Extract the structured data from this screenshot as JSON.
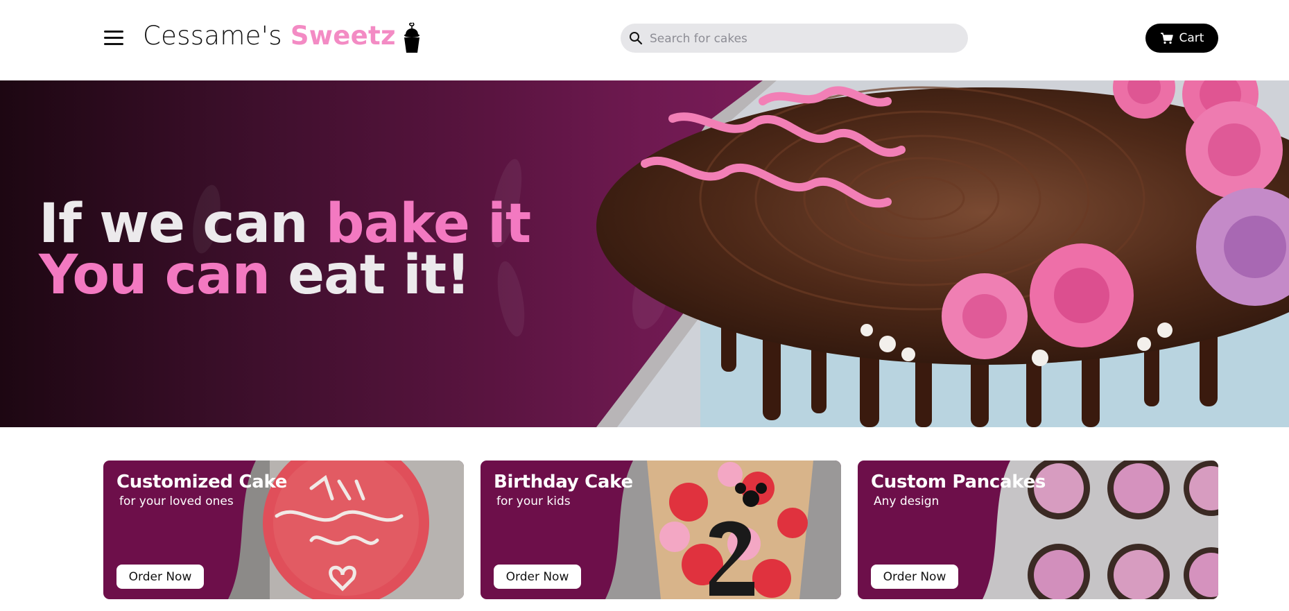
{
  "header": {
    "brand_main": "Cessame's ",
    "brand_accent": "Sweetz",
    "search_placeholder": "Search for cakes",
    "cart_label": "Cart"
  },
  "hero": {
    "line1_white": "If we can ",
    "line1_pink": "bake it",
    "line2_pink": "You can ",
    "line2_white": "eat it!"
  },
  "cards": [
    {
      "title": "Customized Cake",
      "subtitle": "for your loved ones",
      "button": "Order Now"
    },
    {
      "title": "Birthday Cake",
      "subtitle": "for your kids",
      "button": "Order Now"
    },
    {
      "title": "Custom Pancakes",
      "subtitle": "Any design",
      "button": "Order Now"
    }
  ],
  "colors": {
    "accent_pink": "#f38bc4",
    "hero_purple": "#6e1950",
    "card_purple": "#6d0f4a"
  },
  "icons": [
    "menu-icon",
    "cupcake-icon",
    "search-icon",
    "cart-icon"
  ]
}
